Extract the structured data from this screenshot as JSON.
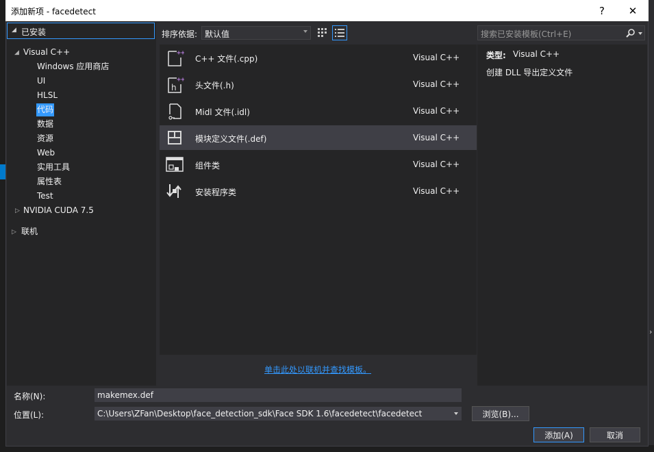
{
  "window": {
    "title": "添加新项 - facedetect",
    "help_label": "?",
    "close_label": "✕"
  },
  "tree": {
    "installed_label": "已安装",
    "root": "Visual C++",
    "children": [
      "Windows 应用商店",
      "UI",
      "HLSL",
      "代码",
      "数据",
      "资源",
      "Web",
      "实用工具",
      "属性表",
      "Test"
    ],
    "selected": "代码",
    "cuda": "NVIDIA CUDA 7.5",
    "online": "联机"
  },
  "sort": {
    "label": "排序依据:",
    "value": "默认值"
  },
  "templates": [
    {
      "name": "C++ 文件(.cpp)",
      "lang": "Visual C++",
      "icon": "cpp-file-icon"
    },
    {
      "name": "头文件(.h)",
      "lang": "Visual C++",
      "icon": "header-file-icon"
    },
    {
      "name": "Midl 文件(.idl)",
      "lang": "Visual C++",
      "icon": "midl-file-icon"
    },
    {
      "name": "模块定义文件(.def)",
      "lang": "Visual C++",
      "icon": "module-def-icon"
    },
    {
      "name": "组件类",
      "lang": "Visual C++",
      "icon": "component-class-icon"
    },
    {
      "name": "安装程序类",
      "lang": "Visual C++",
      "icon": "installer-class-icon"
    }
  ],
  "search": {
    "placeholder": "搜索已安装模板(Ctrl+E)"
  },
  "details": {
    "type_label": "类型:",
    "type_value": "Visual C++",
    "description": "创建 DLL 导出定义文件"
  },
  "online_link": "单击此处以联机并查找模板。",
  "form": {
    "name_label": "名称(N):",
    "name_value": "makemex.def",
    "location_label": "位置(L):",
    "location_value": "C:\\Users\\ZFan\\Desktop\\face_detection_sdk\\Face SDK 1.6\\facedetect\\facedetect",
    "browse_label": "浏览(B)...",
    "add_label": "添加(A)",
    "cancel_label": "取消"
  },
  "colors": {
    "accent": "#3399ff",
    "background": "#2d2d30",
    "panel": "#252526",
    "selected_row": "#3f3f46"
  }
}
